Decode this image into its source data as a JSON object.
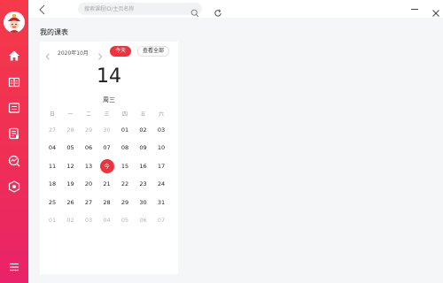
{
  "sidebar": {
    "items": [
      {
        "icon": "home-icon"
      },
      {
        "icon": "book-icon"
      },
      {
        "icon": "list-icon"
      },
      {
        "icon": "document-icon"
      },
      {
        "icon": "chart-search-icon"
      },
      {
        "icon": "settings-hexagon-icon"
      }
    ],
    "menu_icon": "menu-icon",
    "colors": {
      "top": "#f53a4a",
      "bottom": "#e9226a"
    }
  },
  "topbar": {
    "search_placeholder": "搜索课程ID/主页名称"
  },
  "page": {
    "title": "我的课表"
  },
  "calendar": {
    "month_label": "2020年10月",
    "today_label": "今天",
    "view_all_label": "查看全部",
    "big_day": "14",
    "big_weekday": "周三",
    "weekdays": [
      "日",
      "一",
      "二",
      "三",
      "四",
      "五",
      "六"
    ],
    "weeks": [
      [
        "27",
        "28",
        "29",
        "30",
        "01",
        "02",
        "03"
      ],
      [
        "04",
        "05",
        "06",
        "07",
        "08",
        "09",
        "10"
      ],
      [
        "11",
        "12",
        "13",
        "今",
        "15",
        "16",
        "17"
      ],
      [
        "18",
        "19",
        "20",
        "21",
        "22",
        "23",
        "24"
      ],
      [
        "25",
        "26",
        "27",
        "28",
        "29",
        "30",
        "31"
      ],
      [
        "01",
        "02",
        "03",
        "04",
        "05",
        "06",
        "07"
      ]
    ],
    "muted_cells": [
      [
        0,
        0
      ],
      [
        0,
        1
      ],
      [
        0,
        2
      ],
      [
        0,
        3
      ],
      [
        5,
        0
      ],
      [
        5,
        1
      ],
      [
        5,
        2
      ],
      [
        5,
        3
      ],
      [
        5,
        4
      ],
      [
        5,
        5
      ],
      [
        5,
        6
      ]
    ],
    "selected_cell": [
      2,
      3
    ],
    "accent_color": "#f0323c"
  }
}
